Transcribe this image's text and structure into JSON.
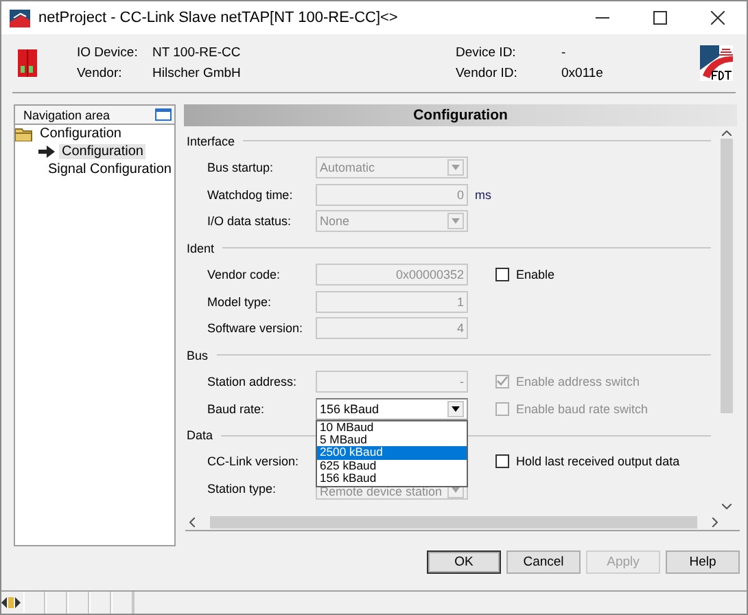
{
  "window": {
    "title": "netProject - CC-Link Slave netTAP[NT 100-RE-CC]<>"
  },
  "device_info": [
    {
      "label": "IO Device:",
      "value": "NT 100-RE-CC"
    },
    {
      "label": "Vendor:",
      "value": "Hilscher GmbH"
    },
    {
      "label": "Device ID:",
      "value": "-"
    },
    {
      "label": "Vendor ID:",
      "value": "0x011e"
    }
  ],
  "navigation": {
    "title": "Navigation area",
    "items": [
      {
        "label": "Configuration",
        "selected": false,
        "children": [
          {
            "label": "Configuration",
            "selected": true
          },
          {
            "label": "Signal Configuration",
            "selected": false
          }
        ]
      }
    ]
  },
  "panel": {
    "title": "Configuration",
    "sections": [
      {
        "title": "Interface",
        "rows": [
          {
            "label": "Bus startup:",
            "kind": "combo",
            "value": "Automatic",
            "disabled": true
          },
          {
            "label": "Watchdog time:",
            "kind": "text",
            "value": "0",
            "unit": "ms",
            "disabled": true
          },
          {
            "label": "I/O data status:",
            "kind": "combo",
            "value": "None",
            "disabled": true
          }
        ]
      },
      {
        "title": "Ident",
        "rows": [
          {
            "label": "Vendor code:",
            "kind": "text",
            "value": "0x00000352",
            "disabled": true,
            "checkbox": {
              "label": "Enable",
              "checked": false,
              "disabled": false
            }
          },
          {
            "label": "Model type:",
            "kind": "text",
            "value": "1",
            "disabled": true
          },
          {
            "label": "Software version:",
            "kind": "text",
            "value": "4",
            "disabled": true
          }
        ]
      },
      {
        "title": "Bus",
        "rows": [
          {
            "label": "Station address:",
            "kind": "text",
            "value": "-",
            "disabled": true,
            "checkbox": {
              "label": "Enable address switch",
              "checked": true,
              "disabled": true
            }
          },
          {
            "label": "Baud rate:",
            "kind": "combo",
            "value": "156 kBaud",
            "disabled": false,
            "checkbox": {
              "label": "Enable baud rate switch",
              "checked": false,
              "disabled": true
            },
            "options": [
              {
                "label": "10 MBaud",
                "highlighted": false
              },
              {
                "label": "5 MBaud",
                "highlighted": false
              },
              {
                "label": "2500 kBaud",
                "highlighted": true
              },
              {
                "label": "625 kBaud",
                "highlighted": false
              },
              {
                "label": "156 kBaud",
                "highlighted": false
              }
            ]
          }
        ]
      },
      {
        "title": "Data",
        "rows": [
          {
            "label": "CC-Link version:",
            "kind": "hidden",
            "checkbox": {
              "label": "Hold last received output data",
              "checked": false,
              "disabled": false
            }
          },
          {
            "label": "Station type:",
            "kind": "combo",
            "value": "Remote device station",
            "disabled": true
          }
        ]
      }
    ]
  },
  "buttons": [
    {
      "label": "OK",
      "disabled": false,
      "default": true
    },
    {
      "label": "Cancel",
      "disabled": false,
      "default": false
    },
    {
      "label": "Apply",
      "disabled": true,
      "default": false
    },
    {
      "label": "Help",
      "disabled": false,
      "default": false
    }
  ]
}
